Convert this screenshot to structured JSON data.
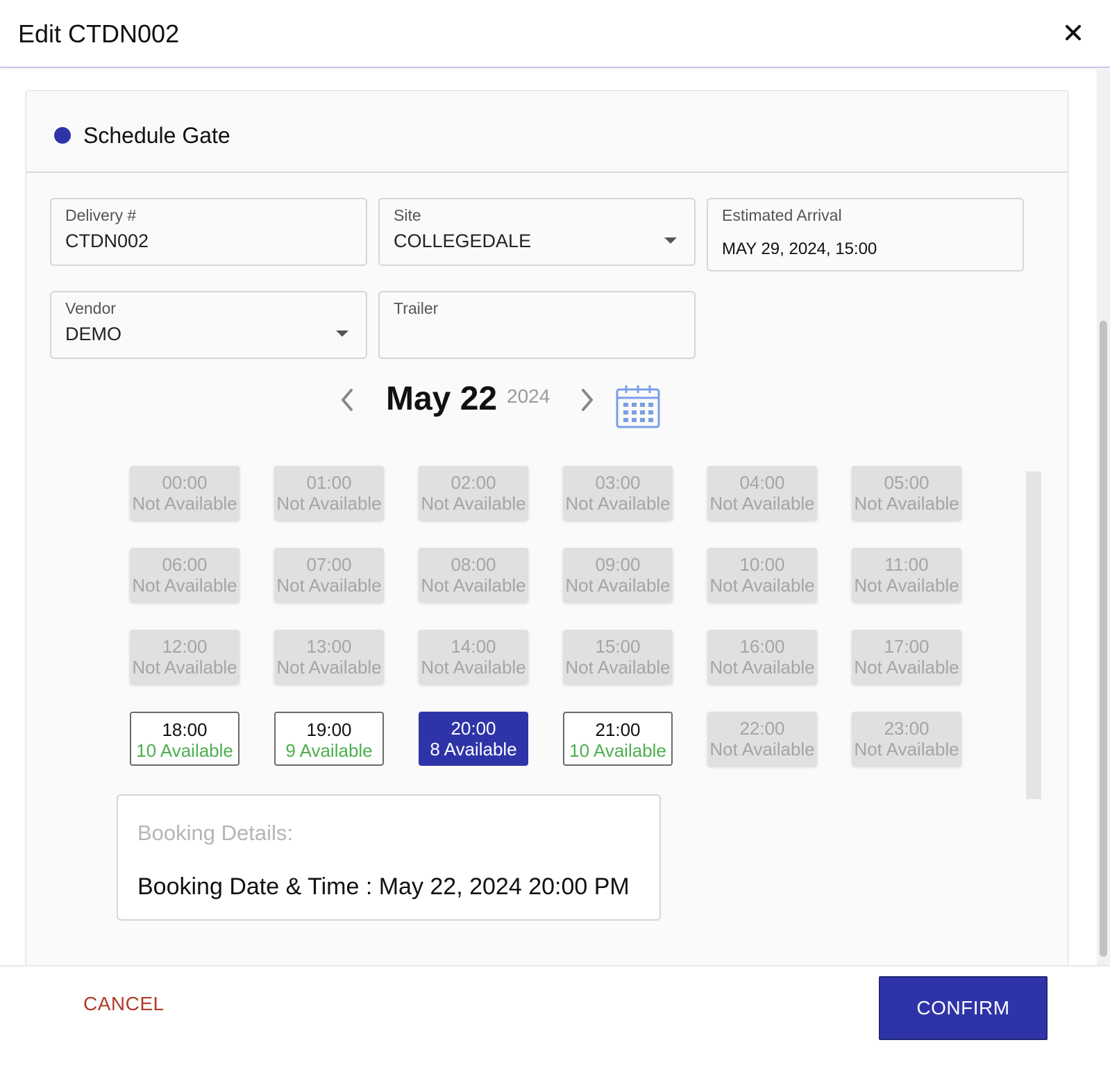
{
  "header": {
    "title": "Edit CTDN002"
  },
  "section": {
    "title": "Schedule Gate"
  },
  "fields": {
    "delivery": {
      "label": "Delivery #",
      "value": "CTDN002"
    },
    "site": {
      "label": "Site",
      "value": "COLLEGEDALE"
    },
    "arrival": {
      "label": "Estimated Arrival",
      "value": "MAY 29, 2024, 15:00"
    },
    "vendor": {
      "label": "Vendor",
      "value": "DEMO"
    },
    "trailer": {
      "label": "Trailer",
      "value": ""
    }
  },
  "date_nav": {
    "date": "May 22",
    "year": "2024"
  },
  "slots": [
    {
      "time": "00:00",
      "status": "Not Available",
      "state": "na"
    },
    {
      "time": "01:00",
      "status": "Not Available",
      "state": "na"
    },
    {
      "time": "02:00",
      "status": "Not Available",
      "state": "na"
    },
    {
      "time": "03:00",
      "status": "Not Available",
      "state": "na"
    },
    {
      "time": "04:00",
      "status": "Not Available",
      "state": "na"
    },
    {
      "time": "05:00",
      "status": "Not Available",
      "state": "na"
    },
    {
      "time": "06:00",
      "status": "Not Available",
      "state": "na"
    },
    {
      "time": "07:00",
      "status": "Not Available",
      "state": "na"
    },
    {
      "time": "08:00",
      "status": "Not Available",
      "state": "na"
    },
    {
      "time": "09:00",
      "status": "Not Available",
      "state": "na"
    },
    {
      "time": "10:00",
      "status": "Not Available",
      "state": "na"
    },
    {
      "time": "11:00",
      "status": "Not Available",
      "state": "na"
    },
    {
      "time": "12:00",
      "status": "Not Available",
      "state": "na"
    },
    {
      "time": "13:00",
      "status": "Not Available",
      "state": "na"
    },
    {
      "time": "14:00",
      "status": "Not Available",
      "state": "na"
    },
    {
      "time": "15:00",
      "status": "Not Available",
      "state": "na"
    },
    {
      "time": "16:00",
      "status": "Not Available",
      "state": "na"
    },
    {
      "time": "17:00",
      "status": "Not Available",
      "state": "na"
    },
    {
      "time": "18:00",
      "status": "10 Available",
      "state": "av"
    },
    {
      "time": "19:00",
      "status": "9 Available",
      "state": "av"
    },
    {
      "time": "20:00",
      "status": "8 Available",
      "state": "sel"
    },
    {
      "time": "21:00",
      "status": "10 Available",
      "state": "av"
    },
    {
      "time": "22:00",
      "status": "Not Available",
      "state": "na"
    },
    {
      "time": "23:00",
      "status": "Not Available",
      "state": "na"
    }
  ],
  "booking": {
    "title": "Booking Details:",
    "line": "Booking Date & Time : May 22, 2024 20:00 PM"
  },
  "footer": {
    "cancel_label": "CANCEL",
    "confirm_label": "CONFIRM"
  },
  "colors": {
    "accent": "#2e34a8",
    "available": "#4caf50",
    "cancel": "#b23a2a"
  },
  "icons": {
    "close": "close-icon",
    "prev": "chevron-left-icon",
    "next": "chevron-right-icon",
    "calendar": "calendar-icon",
    "dropdown": "caret-down-icon"
  }
}
